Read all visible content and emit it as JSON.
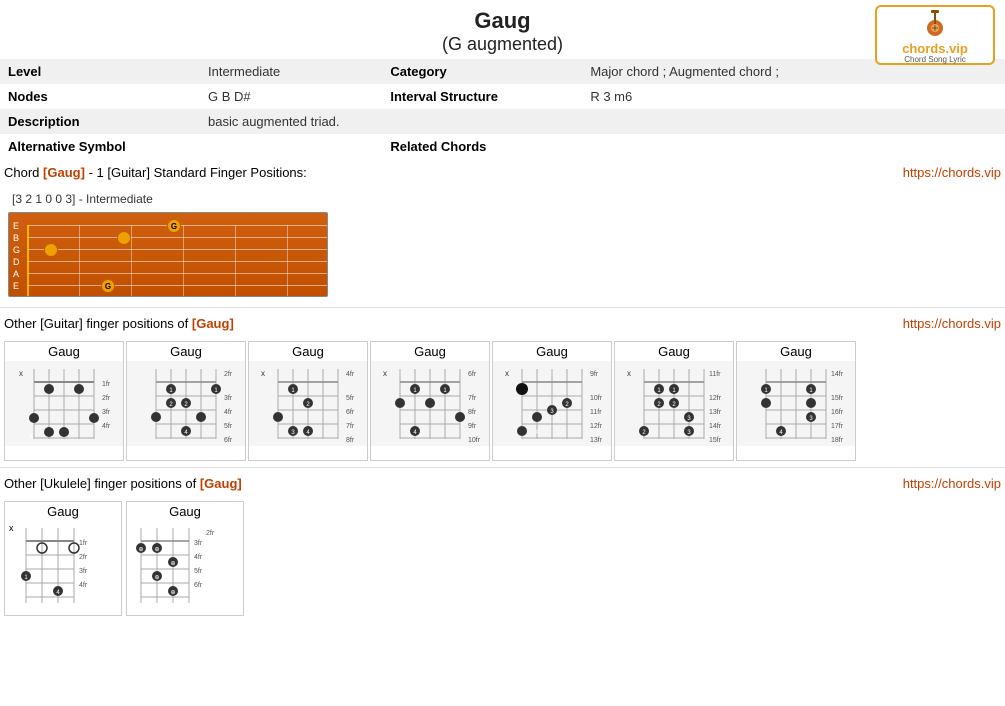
{
  "header": {
    "title": "Gaug",
    "subtitle": "(G augmented)"
  },
  "logo": {
    "url": "https://chords.vip",
    "text": "chords.vip",
    "sub": "Chord Song Lyric"
  },
  "info": {
    "level_label": "Level",
    "level_value": "Intermediate",
    "category_label": "Category",
    "category_value": "Major chord ; Augmented chord ;",
    "nodes_label": "Nodes",
    "nodes_value": "G B D#",
    "interval_label": "Interval Structure",
    "interval_value": "R 3 m6",
    "description_label": "Description",
    "description_value": "basic augmented triad.",
    "alt_symbol_label": "Alternative Symbol",
    "related_label": "Related Chords"
  },
  "chord_section": {
    "prefix": "Chord",
    "chord_name": "[Gaug]",
    "suffix": "- 1 [Guitar] Standard Finger Positions:",
    "url": "https://chords.vip",
    "fingering": "[3 2 1 0 0 3] - Intermediate"
  },
  "other_guitar": {
    "prefix": "Other [Guitar] finger positions of",
    "chord_name": "[Gaug]",
    "url": "https://chords.vip",
    "chords": [
      {
        "title": "Gaug",
        "x": "x",
        "fret_start": "",
        "markers": []
      },
      {
        "title": "Gaug",
        "x": "",
        "fret_start": "2fr",
        "markers": []
      },
      {
        "title": "Gaug",
        "x": "x",
        "fret_start": "4fr",
        "markers": []
      },
      {
        "title": "Gaug",
        "x": "x",
        "fret_start": "6fr",
        "markers": []
      },
      {
        "title": "Gaug",
        "x": "x",
        "fret_start": "9fr",
        "markers": []
      },
      {
        "title": "Gaug",
        "x": "x",
        "fret_start": "11fr",
        "markers": []
      },
      {
        "title": "Gaug",
        "x": "",
        "fret_start": "14fr",
        "markers": []
      }
    ]
  },
  "other_ukulele": {
    "prefix": "Other [Ukulele] finger positions of",
    "chord_name": "[Gaug]",
    "url": "https://chords.vip",
    "chords": [
      {
        "title": "Gaug",
        "x": "x",
        "fret_start": ""
      },
      {
        "title": "Gaug",
        "x": "",
        "fret_start": "2fr"
      }
    ]
  }
}
